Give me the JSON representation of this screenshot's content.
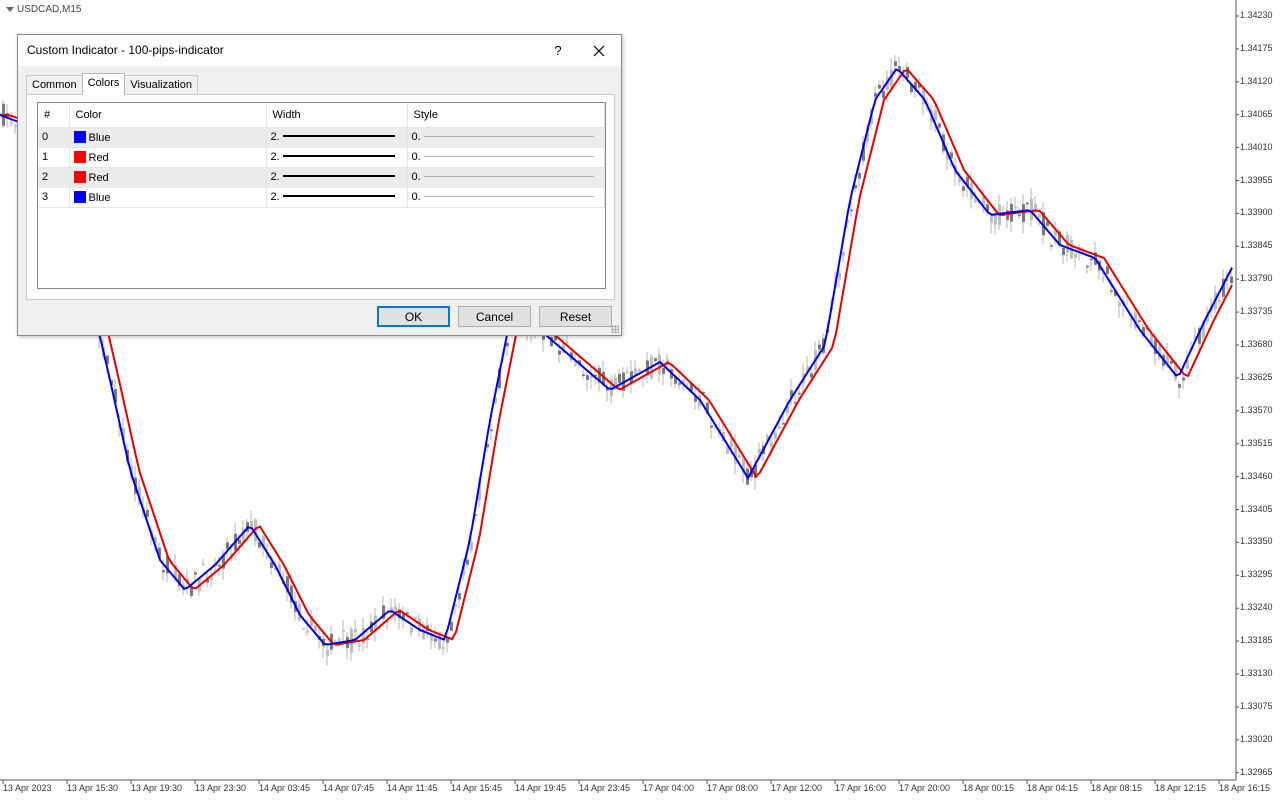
{
  "symbol": "USDCAD,M15",
  "price_axis": [
    "1.34230",
    "1.34175",
    "1.34120",
    "1.34065",
    "1.34010",
    "1.33955",
    "1.33900",
    "1.33845",
    "1.33790",
    "1.33735",
    "1.33680",
    "1.33625",
    "1.33570",
    "1.33515",
    "1.33460",
    "1.33405",
    "1.33350",
    "1.33295",
    "1.33240",
    "1.33185",
    "1.33130",
    "1.33075",
    "1.33020",
    "1.32965"
  ],
  "time_axis": [
    "13 Apr 2023",
    "13 Apr 15:30",
    "13 Apr 19:30",
    "13 Apr 23:30",
    "14 Apr 03:45",
    "14 Apr 07:45",
    "14 Apr 11:45",
    "14 Apr 15:45",
    "14 Apr 19:45",
    "14 Apr 23:45",
    "17 Apr 04:00",
    "17 Apr 08:00",
    "17 Apr 12:00",
    "17 Apr 16:00",
    "17 Apr 20:00",
    "18 Apr 00:15",
    "18 Apr 04:15",
    "18 Apr 08:15",
    "18 Apr 12:15",
    "18 Apr 16:15"
  ],
  "colors": {
    "blue_line": "#0000dd",
    "red_line": "#e00000",
    "candle": "#7a7a7a",
    "swatch_blue": "#0000ff",
    "swatch_red": "#ff0000"
  },
  "dialog": {
    "title": "Custom Indicator - 100-pips-indicator",
    "help": "?",
    "tabs": [
      "Common",
      "Colors",
      "Visualization"
    ],
    "active_tab": "Colors",
    "columns": [
      "#",
      "Color",
      "Width",
      "Style"
    ],
    "rows": [
      {
        "index": "0",
        "color": "Blue",
        "swatch": "#0000ff",
        "width": "2.",
        "style": "0."
      },
      {
        "index": "1",
        "color": "Red",
        "swatch": "#ff0000",
        "width": "2.",
        "style": "0."
      },
      {
        "index": "2",
        "color": "Red",
        "swatch": "#ff0000",
        "width": "2.",
        "style": "0."
      },
      {
        "index": "3",
        "color": "Blue",
        "swatch": "#0000ff",
        "width": "2.",
        "style": "0."
      }
    ],
    "buttons": {
      "ok": "OK",
      "cancel": "Cancel",
      "reset": "Reset"
    }
  }
}
